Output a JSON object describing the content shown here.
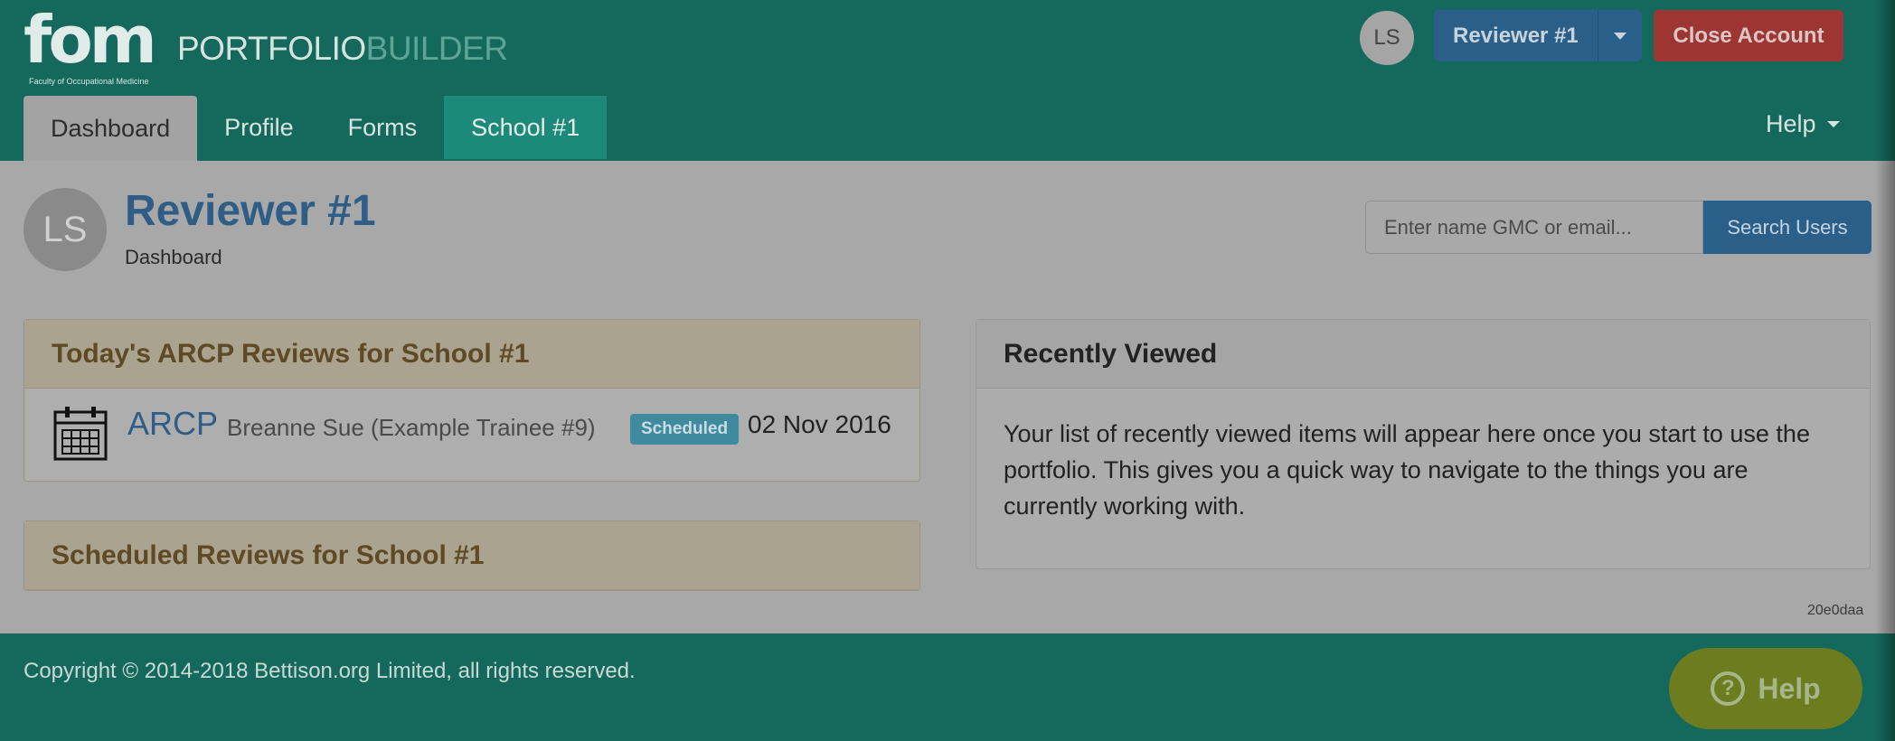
{
  "header": {
    "logo_text": "fom",
    "logo_subtitle": "Faculty of Occupational Medicine",
    "brand_part1": "PORTFOLIO",
    "brand_part2": "BUILDER",
    "avatar_initials": "LS",
    "user_button_label": "Reviewer #1",
    "close_account_label": "Close Account",
    "tabs": [
      {
        "label": "Dashboard",
        "active": true
      },
      {
        "label": "Profile"
      },
      {
        "label": "Forms"
      },
      {
        "label": "School #1"
      }
    ],
    "help_label": "Help"
  },
  "page": {
    "avatar_initials": "LS",
    "title": "Reviewer #1",
    "subtitle": "Dashboard",
    "search_placeholder": "Enter name GMC or email...",
    "search_button": "Search Users"
  },
  "todays_reviews": {
    "heading": "Today's ARCP Reviews for School #1",
    "items": [
      {
        "type": "ARCP",
        "name": "Breanne Sue (Example Trainee #9)",
        "status": "Scheduled",
        "date": "02 Nov 2016"
      }
    ]
  },
  "scheduled_reviews": {
    "heading": "Scheduled Reviews for School #1"
  },
  "recently_viewed": {
    "heading": "Recently Viewed",
    "body": "Your list of recently viewed items will appear here once you start to use the portfolio. This gives you a quick way to navigate to the things you are currently working with."
  },
  "version": "20e0daa",
  "footer": {
    "copyright": "Copyright © 2014-2018 Bettison.org Limited, all rights reserved.",
    "help_button": "Help"
  },
  "colors": {
    "header_bg": "#15695c",
    "primary": "#2a5f8a",
    "danger": "#9d3532",
    "info": "#3f8a9e",
    "help_float": "#6c7c1f"
  }
}
